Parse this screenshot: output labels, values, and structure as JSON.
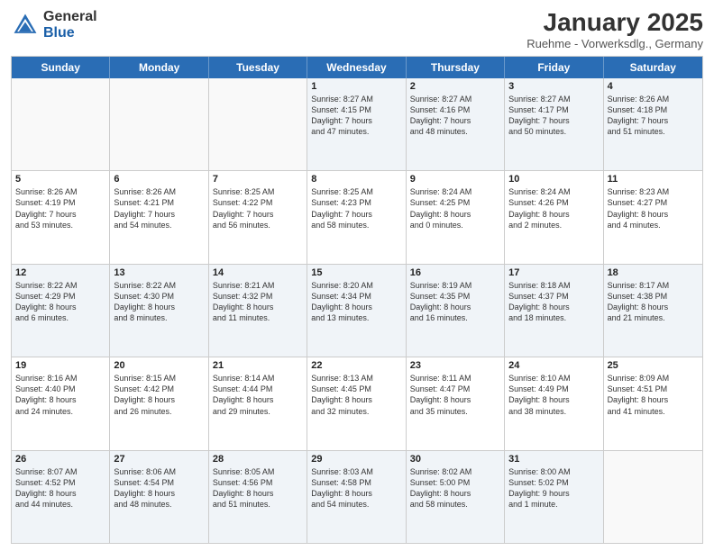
{
  "header": {
    "logo_general": "General",
    "logo_blue": "Blue",
    "month_title": "January 2025",
    "subtitle": "Ruehme - Vorwerksdlg., Germany"
  },
  "weekdays": [
    "Sunday",
    "Monday",
    "Tuesday",
    "Wednesday",
    "Thursday",
    "Friday",
    "Saturday"
  ],
  "weeks": [
    [
      {
        "day": "",
        "info": ""
      },
      {
        "day": "",
        "info": ""
      },
      {
        "day": "",
        "info": ""
      },
      {
        "day": "1",
        "info": "Sunrise: 8:27 AM\nSunset: 4:15 PM\nDaylight: 7 hours\nand 47 minutes."
      },
      {
        "day": "2",
        "info": "Sunrise: 8:27 AM\nSunset: 4:16 PM\nDaylight: 7 hours\nand 48 minutes."
      },
      {
        "day": "3",
        "info": "Sunrise: 8:27 AM\nSunset: 4:17 PM\nDaylight: 7 hours\nand 50 minutes."
      },
      {
        "day": "4",
        "info": "Sunrise: 8:26 AM\nSunset: 4:18 PM\nDaylight: 7 hours\nand 51 minutes."
      }
    ],
    [
      {
        "day": "5",
        "info": "Sunrise: 8:26 AM\nSunset: 4:19 PM\nDaylight: 7 hours\nand 53 minutes."
      },
      {
        "day": "6",
        "info": "Sunrise: 8:26 AM\nSunset: 4:21 PM\nDaylight: 7 hours\nand 54 minutes."
      },
      {
        "day": "7",
        "info": "Sunrise: 8:25 AM\nSunset: 4:22 PM\nDaylight: 7 hours\nand 56 minutes."
      },
      {
        "day": "8",
        "info": "Sunrise: 8:25 AM\nSunset: 4:23 PM\nDaylight: 7 hours\nand 58 minutes."
      },
      {
        "day": "9",
        "info": "Sunrise: 8:24 AM\nSunset: 4:25 PM\nDaylight: 8 hours\nand 0 minutes."
      },
      {
        "day": "10",
        "info": "Sunrise: 8:24 AM\nSunset: 4:26 PM\nDaylight: 8 hours\nand 2 minutes."
      },
      {
        "day": "11",
        "info": "Sunrise: 8:23 AM\nSunset: 4:27 PM\nDaylight: 8 hours\nand 4 minutes."
      }
    ],
    [
      {
        "day": "12",
        "info": "Sunrise: 8:22 AM\nSunset: 4:29 PM\nDaylight: 8 hours\nand 6 minutes."
      },
      {
        "day": "13",
        "info": "Sunrise: 8:22 AM\nSunset: 4:30 PM\nDaylight: 8 hours\nand 8 minutes."
      },
      {
        "day": "14",
        "info": "Sunrise: 8:21 AM\nSunset: 4:32 PM\nDaylight: 8 hours\nand 11 minutes."
      },
      {
        "day": "15",
        "info": "Sunrise: 8:20 AM\nSunset: 4:34 PM\nDaylight: 8 hours\nand 13 minutes."
      },
      {
        "day": "16",
        "info": "Sunrise: 8:19 AM\nSunset: 4:35 PM\nDaylight: 8 hours\nand 16 minutes."
      },
      {
        "day": "17",
        "info": "Sunrise: 8:18 AM\nSunset: 4:37 PM\nDaylight: 8 hours\nand 18 minutes."
      },
      {
        "day": "18",
        "info": "Sunrise: 8:17 AM\nSunset: 4:38 PM\nDaylight: 8 hours\nand 21 minutes."
      }
    ],
    [
      {
        "day": "19",
        "info": "Sunrise: 8:16 AM\nSunset: 4:40 PM\nDaylight: 8 hours\nand 24 minutes."
      },
      {
        "day": "20",
        "info": "Sunrise: 8:15 AM\nSunset: 4:42 PM\nDaylight: 8 hours\nand 26 minutes."
      },
      {
        "day": "21",
        "info": "Sunrise: 8:14 AM\nSunset: 4:44 PM\nDaylight: 8 hours\nand 29 minutes."
      },
      {
        "day": "22",
        "info": "Sunrise: 8:13 AM\nSunset: 4:45 PM\nDaylight: 8 hours\nand 32 minutes."
      },
      {
        "day": "23",
        "info": "Sunrise: 8:11 AM\nSunset: 4:47 PM\nDaylight: 8 hours\nand 35 minutes."
      },
      {
        "day": "24",
        "info": "Sunrise: 8:10 AM\nSunset: 4:49 PM\nDaylight: 8 hours\nand 38 minutes."
      },
      {
        "day": "25",
        "info": "Sunrise: 8:09 AM\nSunset: 4:51 PM\nDaylight: 8 hours\nand 41 minutes."
      }
    ],
    [
      {
        "day": "26",
        "info": "Sunrise: 8:07 AM\nSunset: 4:52 PM\nDaylight: 8 hours\nand 44 minutes."
      },
      {
        "day": "27",
        "info": "Sunrise: 8:06 AM\nSunset: 4:54 PM\nDaylight: 8 hours\nand 48 minutes."
      },
      {
        "day": "28",
        "info": "Sunrise: 8:05 AM\nSunset: 4:56 PM\nDaylight: 8 hours\nand 51 minutes."
      },
      {
        "day": "29",
        "info": "Sunrise: 8:03 AM\nSunset: 4:58 PM\nDaylight: 8 hours\nand 54 minutes."
      },
      {
        "day": "30",
        "info": "Sunrise: 8:02 AM\nSunset: 5:00 PM\nDaylight: 8 hours\nand 58 minutes."
      },
      {
        "day": "31",
        "info": "Sunrise: 8:00 AM\nSunset: 5:02 PM\nDaylight: 9 hours\nand 1 minute."
      },
      {
        "day": "",
        "info": ""
      }
    ]
  ]
}
